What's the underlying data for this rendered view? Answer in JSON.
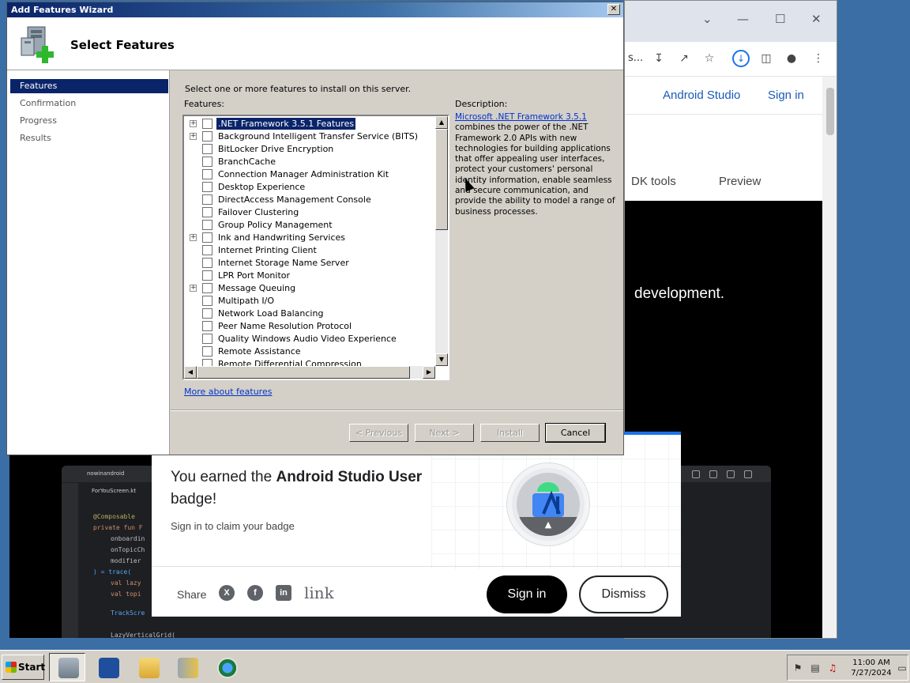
{
  "browser": {
    "address_fragment": "s...",
    "nav": {
      "product": "Android Studio",
      "sign_in": "Sign in"
    },
    "tabs": {
      "sdk_tools": "DK tools",
      "preview": "Preview"
    },
    "hero_text": "development."
  },
  "ide": {
    "project_tab": "nowinandroid",
    "file_tab": "ForYouScreen.kt",
    "code_lines": [
      "@Composable",
      "private fun F",
      "onboardin",
      "onTopicCh",
      "modifier",
      ") = trace(",
      "val lazy",
      "val topi",
      "TrackScre",
      "LazyVerticalGrid("
    ]
  },
  "badge": {
    "title_pre": "You earned the",
    "title_bold": "Android Studio User",
    "title_post": "badge!",
    "subtitle": "Sign in to claim your badge",
    "share_label": "Share",
    "link_label": "link",
    "sign_in": "Sign in",
    "dismiss": "Dismiss"
  },
  "wizard": {
    "window_title": "Add Features Wizard",
    "heading": "Select Features",
    "nav": [
      "Features",
      "Confirmation",
      "Progress",
      "Results"
    ],
    "active_nav": "Features",
    "instruction": "Select one or more features to install on this server.",
    "features_label": "Features:",
    "description_label": "Description:",
    "description_link": "Microsoft .NET Framework 3.5.1",
    "description_text": "combines the power of the .NET Framework 2.0 APIs with new technologies for building applications that offer appealing user interfaces, protect your customers' personal identity information, enable seamless and secure communication, and provide the ability to model a range of business processes.",
    "features": [
      {
        "label": ".NET Framework 3.5.1 Features",
        "expandable": true,
        "selected": true
      },
      {
        "label": "Background Intelligent Transfer Service (BITS)",
        "expandable": true
      },
      {
        "label": "BitLocker Drive Encryption"
      },
      {
        "label": "BranchCache"
      },
      {
        "label": "Connection Manager Administration Kit"
      },
      {
        "label": "Desktop Experience"
      },
      {
        "label": "DirectAccess Management Console"
      },
      {
        "label": "Failover Clustering"
      },
      {
        "label": "Group Policy Management"
      },
      {
        "label": "Ink and Handwriting Services",
        "expandable": true
      },
      {
        "label": "Internet Printing Client"
      },
      {
        "label": "Internet Storage Name Server"
      },
      {
        "label": "LPR Port Monitor"
      },
      {
        "label": "Message Queuing",
        "expandable": true
      },
      {
        "label": "Multipath I/O"
      },
      {
        "label": "Network Load Balancing"
      },
      {
        "label": "Peer Name Resolution Protocol"
      },
      {
        "label": "Quality Windows Audio Video Experience"
      },
      {
        "label": "Remote Assistance"
      },
      {
        "label": "Remote Differential Compression"
      }
    ],
    "more_link": "More about features",
    "buttons": {
      "previous": "< Previous",
      "next": "Next >",
      "install": "Install",
      "cancel": "Cancel"
    }
  },
  "taskbar": {
    "start": "Start",
    "time": "11:00 AM",
    "date": "7/27/2024"
  }
}
